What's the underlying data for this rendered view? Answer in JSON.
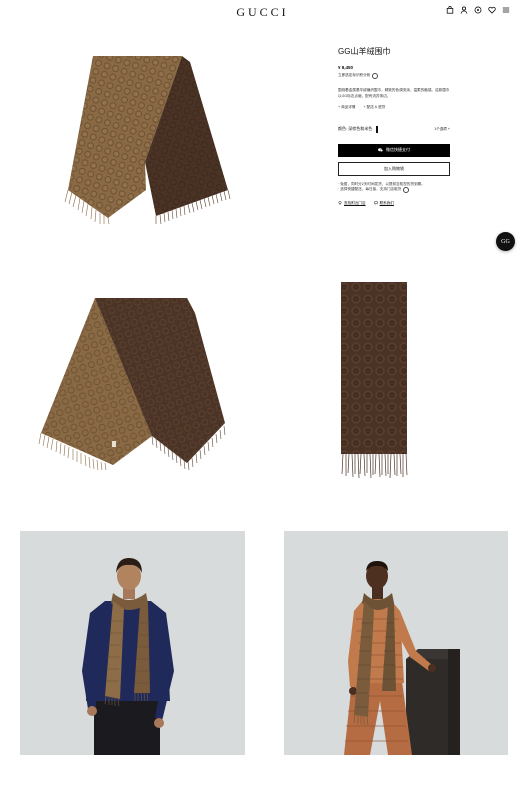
{
  "header": {
    "logo": "GUCCI",
    "icons": [
      "bag-icon",
      "account-icon",
      "location-icon",
      "heart-icon",
      "menu-icon"
    ]
  },
  "product": {
    "title": "GG山羊绒围巾",
    "price": "¥ 8,450",
    "payment_link": "立即选定标识积分帐",
    "description": "围绕着金属基羊绒编织围巾，精致的色调流淌，温柔的触感。这款围巾以GG标志点缀，配有流苏饰边。",
    "bullet_1": "商品详情",
    "bullet_2": "配送 & 退货",
    "color_label": "颜色: 深棕色和米色",
    "size_label": "1个选项",
    "wechat_button": "微信快捷支付",
    "add_to_bag_button": "加入购物袋",
    "note_1": "· 免费，同时分2天时间发货，以提前告知您的货到期。",
    "note_2": "· 选择快捷配送，每日接，支持门店取货",
    "link_store": "查找附近门店",
    "link_consult": "联系我们"
  },
  "floating": {
    "label": "GG"
  },
  "colors": {
    "scarf_camel": "#8a6a45",
    "scarf_brown": "#4a3325",
    "button_black": "#000000",
    "photo_bg": "#d8dbdc"
  }
}
